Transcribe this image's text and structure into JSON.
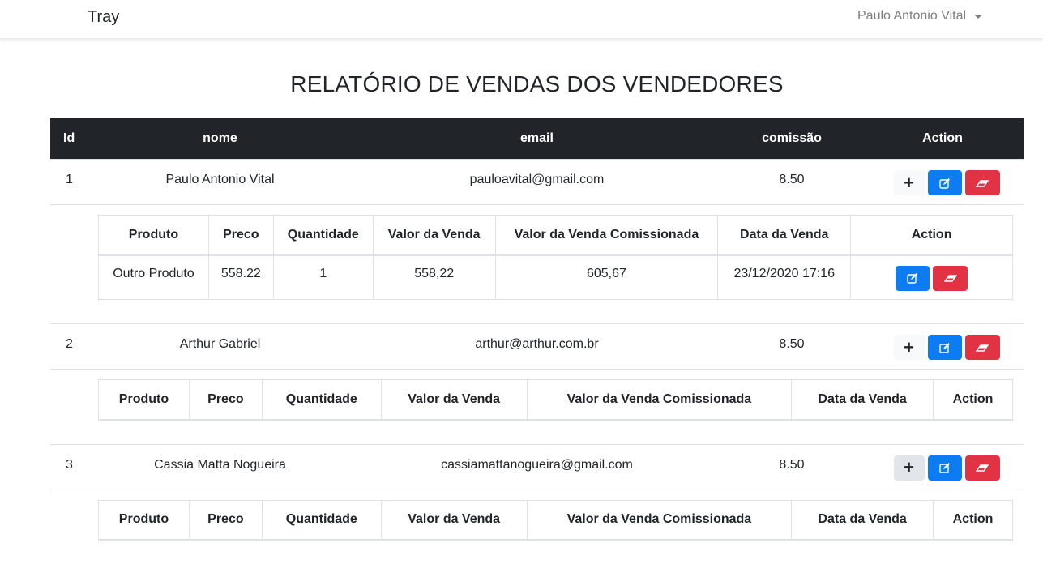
{
  "navbar": {
    "brand": "Tray",
    "user_name": "Paulo Antonio Vital"
  },
  "page": {
    "title": "RELATÓRIO DE VENDAS DOS VENDEDORES"
  },
  "main_table": {
    "headers": {
      "id": "Id",
      "nome": "nome",
      "email": "email",
      "comissao": "comissão",
      "action": "Action"
    }
  },
  "sub_table": {
    "headers": {
      "produto": "Produto",
      "preco": "Preco",
      "quantidade": "Quantidade",
      "valor_venda": "Valor da Venda",
      "valor_comissionada": "Valor da Venda Comissionada",
      "data_venda": "Data da Venda",
      "action": "Action"
    }
  },
  "vendors": [
    {
      "id": "1",
      "nome": "Paulo Antonio Vital",
      "email": "pauloavital@gmail.com",
      "comissao": "8.50",
      "sales": [
        {
          "produto": "Outro Produto",
          "preco": "558.22",
          "quantidade": "1",
          "valor_venda": "558,22",
          "valor_comissionada": "605,67",
          "data_venda": "23/12/2020 17:16"
        }
      ]
    },
    {
      "id": "2",
      "nome": "Arthur Gabriel",
      "email": "arthur@arthur.com.br",
      "comissao": "8.50",
      "sales": []
    },
    {
      "id": "3",
      "nome": "Cassia Matta Nogueira",
      "email": "cassiamattanogueira@gmail.com",
      "comissao": "8.50",
      "sales": []
    }
  ],
  "icons": {
    "add": "plus-icon",
    "edit": "edit-icon",
    "delete": "eraser-icon"
  },
  "colors": {
    "header_bg": "#212529",
    "primary": "#0d7cf2",
    "danger": "#e23345",
    "light": "#f8f9fa"
  }
}
